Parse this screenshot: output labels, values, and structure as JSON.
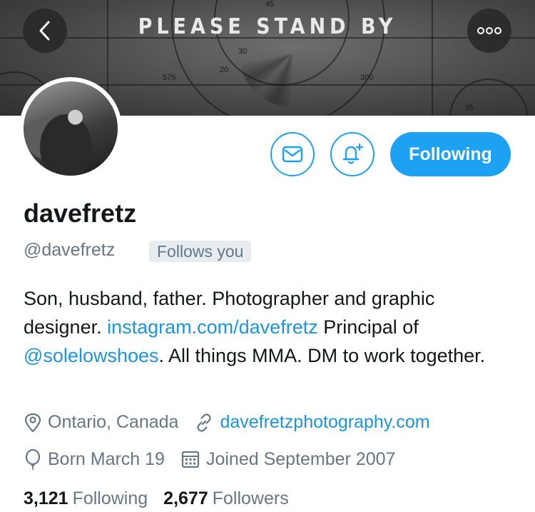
{
  "banner": {
    "title": "PLEASE STAND BY",
    "numbers": [
      "45",
      "30",
      "20",
      "575",
      "300",
      "35"
    ]
  },
  "profile": {
    "name": "davefretz",
    "handle": "@davefretz",
    "follows_you": "Follows you",
    "bio": {
      "t1": "Son, husband, father. Photographer and graphic designer. ",
      "link1": "instagram.com/davefretz",
      "t2": " Principal of ",
      "link2": "@solelowshoes",
      "t3": ". All things MMA. DM to work together."
    },
    "location": "Ontario, Canada",
    "website": "davefretzphotography.com",
    "birthday": "Born March 19",
    "joined": "Joined September 2007"
  },
  "actions": {
    "following_label": "Following"
  },
  "stats": {
    "following_count": "3,121",
    "following_label": "Following",
    "followers_count": "2,677",
    "followers_label": "Followers"
  },
  "colors": {
    "accent": "#1da1f2",
    "link": "#1b95e0",
    "secondary_text": "#657786"
  },
  "icons": [
    "back-arrow-icon",
    "more-options-icon",
    "mail-icon",
    "notification-bell-icon",
    "location-pin-icon",
    "link-icon",
    "birthday-balloon-icon",
    "calendar-icon"
  ]
}
